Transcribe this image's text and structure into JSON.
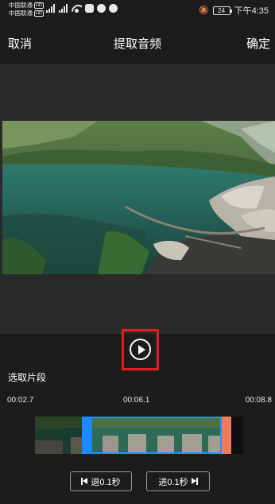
{
  "status_bar": {
    "carrier_1": "中国联通",
    "carrier_2": "中国联通",
    "hd_badge": "HD",
    "battery": "24",
    "time": "下午4:35"
  },
  "nav": {
    "cancel_label": "取消",
    "title": "提取音频",
    "confirm_label": "确定"
  },
  "player": {
    "play_icon": "play-icon",
    "highlight_color": "#e02020"
  },
  "clip": {
    "section_label": "选取片段",
    "time_start": "00:02.7",
    "time_mid": "00:06.1",
    "time_end": "00:08.8",
    "selection_color": "#1e88ff",
    "end_marker_color": "#f07b5c"
  },
  "controls": {
    "back_label": "退0.1秒",
    "forward_label": "进0.1秒"
  }
}
